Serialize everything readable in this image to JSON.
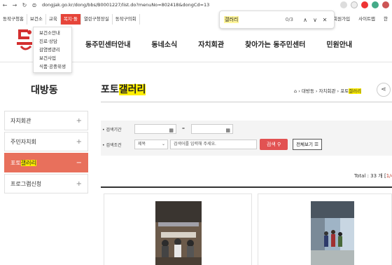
{
  "browser": {
    "url": "dongjak.go.kr/dong/bbs/B0001227/list.do?menuNo=802418&dongCd=13"
  },
  "find": {
    "query": "갤러리",
    "count": "0/3",
    "up": "∧",
    "down": "∨",
    "close": "✕"
  },
  "util_nav": [
    "동작구청홈",
    "보건소",
    "교육",
    "복지·돌",
    "열린구청장실",
    "동작구의회"
  ],
  "util_right": [
    "회원가입",
    "사이트맵",
    "한"
  ],
  "dropdown": [
    "보건소안내",
    "진료·상담",
    "감염병관리",
    "보건사업",
    "식품·공중위생"
  ],
  "main_nav": [
    "동주민센터안내",
    "동네소식",
    "자치회관",
    "찾아가는 동주민센터",
    "민원안내"
  ],
  "side_title": "대방동",
  "page_title": {
    "pre": "포토",
    "hl": "갤러리"
  },
  "breadcrumb": {
    "home": "⌂",
    "parts": "› 대방동 › 자치회관 › 포토",
    "hl": "갤러리"
  },
  "sidebar": [
    {
      "label": "자치회관",
      "sign": "+"
    },
    {
      "label": "주민자치회",
      "sign": "+"
    },
    {
      "label_pre": "포토",
      "label_hl": "갤러리",
      "sign": "−"
    },
    {
      "label": "프로그램신청",
      "sign": "+"
    }
  ],
  "search": {
    "period_label": "검색기간",
    "cond_label": "검색조건",
    "select_value": "제목",
    "keyword_placeholder": "검색어를 입력해 주세요.",
    "search_btn": "검색",
    "all_btn": "전체보기"
  },
  "total": {
    "label": "Total : 33 개 [",
    "page": "1/4"
  },
  "colors": {
    "accent": "#e8705c",
    "highlight": "#ffef00",
    "search_btn": "#e25252"
  }
}
